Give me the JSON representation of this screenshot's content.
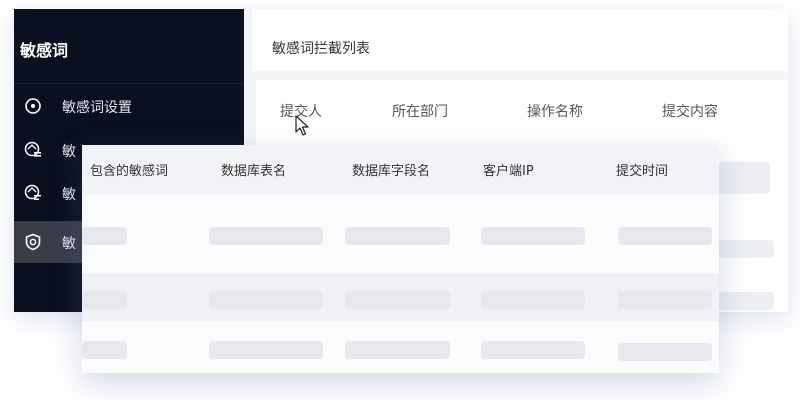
{
  "sidebar": {
    "title": "敏感词",
    "items": [
      {
        "label": "敏感词设置",
        "icon": "target-circle-icon",
        "active": false
      },
      {
        "label": "敏",
        "icon": "settings-list-icon",
        "active": false
      },
      {
        "label": "敏",
        "icon": "settings-sliders-icon",
        "active": false
      },
      {
        "label": "敏",
        "icon": "shield-icon",
        "active": true
      }
    ]
  },
  "main": {
    "title": "敏感词拦截列表",
    "columns": [
      "提交人",
      "所在部门",
      "操作名称",
      "提交内容"
    ]
  },
  "overlay_table": {
    "columns": [
      "包含的敏感词",
      "数据库表名",
      "数据库字段名",
      "客户端IP",
      "提交时间"
    ],
    "rows": 3
  },
  "colors": {
    "sidebar_bg": "#0b1020",
    "active_item_bg": "#3a3d48",
    "skeleton": "#e6e8ec"
  }
}
